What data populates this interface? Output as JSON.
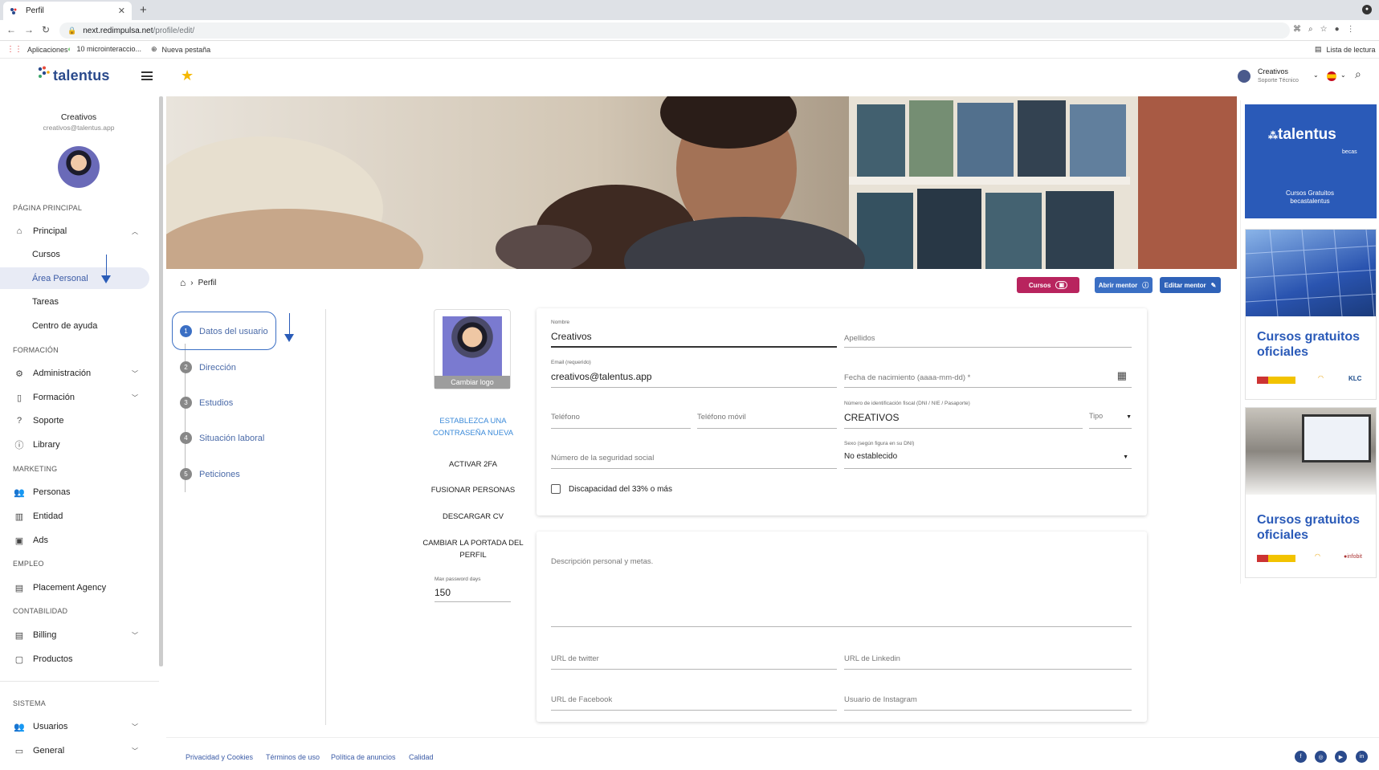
{
  "browser": {
    "tab_title": "Perfil",
    "url_host": "next.redimpulsa.net",
    "url_path": "/profile/edit/",
    "bookmarks": [
      "Aplicaciones",
      "10 microinteraccio...",
      "Nueva pestaña"
    ],
    "reading_list": "Lista de lectura"
  },
  "header": {
    "logo": "talentus",
    "user_name": "Creativos",
    "user_role": "Soporte Técnico"
  },
  "sidebar": {
    "user_name": "Creativos",
    "user_email": "creativos@talentus.app",
    "sections": {
      "principal_page": "PÁGINA PRINCIPAL",
      "formacion": "FORMACIÓN",
      "marketing": "MARKETING",
      "empleo": "EMPLEO",
      "contabilidad": "CONTABILIDAD",
      "sistema": "SISTEMA"
    },
    "items": {
      "principal": "Principal",
      "cursos": "Cursos",
      "area_personal": "Área Personal",
      "tareas": "Tareas",
      "centro_ayuda": "Centro de ayuda",
      "administracion": "Administración",
      "formacion": "Formación",
      "soporte": "Soporte",
      "library": "Library",
      "personas": "Personas",
      "entidad": "Entidad",
      "ads": "Ads",
      "placement": "Placement Agency",
      "billing": "Billing",
      "productos": "Productos",
      "usuarios": "Usuarios",
      "general": "General"
    }
  },
  "breadcrumb": {
    "current": "Perfil"
  },
  "actions": {
    "cursos": "Cursos",
    "abrir_mentor": "Abrir mentor",
    "editar_mentor": "Editar mentor"
  },
  "stepper": [
    {
      "num": "1",
      "label": "Datos del usuario"
    },
    {
      "num": "2",
      "label": "Dirección"
    },
    {
      "num": "3",
      "label": "Estudios"
    },
    {
      "num": "4",
      "label": "Situación laboral"
    },
    {
      "num": "5",
      "label": "Peticiones"
    }
  ],
  "profile_actions": {
    "change_logo": "Cambiar logo",
    "set_password": "ESTABLEZCA UNA CONTRASEÑA NUEVA",
    "activate_2fa": "ACTIVAR 2FA",
    "merge": "FUSIONAR PERSONAS",
    "download_cv": "DESCARGAR CV",
    "change_cover": "CAMBIAR LA PORTADA DEL PERFIL",
    "max_pw_label": "Max password days",
    "max_pw_value": "150"
  },
  "form": {
    "nombre_label": "Nombre",
    "nombre_value": "Creativos",
    "apellidos": "Apellidos",
    "email_label": "Email (requerido)",
    "email_value": "creativos@talentus.app",
    "fecha": "Fecha de nacimiento (aaaa-mm-dd) *",
    "telefono": "Teléfono",
    "movil": "Teléfono móvil",
    "nif_label": "Número de identificación fiscal (DNI / NIE / Pasaporte)",
    "nif_value": "CREATIVOS",
    "tipo": "Tipo",
    "nss": "Número de la seguridad social",
    "sexo_label": "Sexo (según figura en su DNI)",
    "sexo_value": "No establecido",
    "discapacidad": "Discapacidad del 33% o más",
    "descripcion": "Descripción personal y metas.",
    "twitter": "URL de twitter",
    "linkedin": "URL de Linkedin",
    "facebook": "URL de Facebook",
    "instagram": "Usuario de Instagram"
  },
  "ads": {
    "ad1_logo": "talentus",
    "ad1_sub": "becas",
    "ad1_text": "Cursos Gratuitos becastalentus",
    "ad2_title": "Cursos gratuitos oficiales",
    "ad3_title": "Cursos gratuitos oficiales"
  },
  "footer": {
    "privacy": "Privacidad y Cookies",
    "terms": "Términos de uso",
    "ads_policy": "Política de anuncios",
    "quality": "Calidad"
  },
  "colors": {
    "primary": "#2a4a8c",
    "accent": "#3b6fc4",
    "cursos_btn": "#b8245e",
    "star": "#f5b800"
  }
}
